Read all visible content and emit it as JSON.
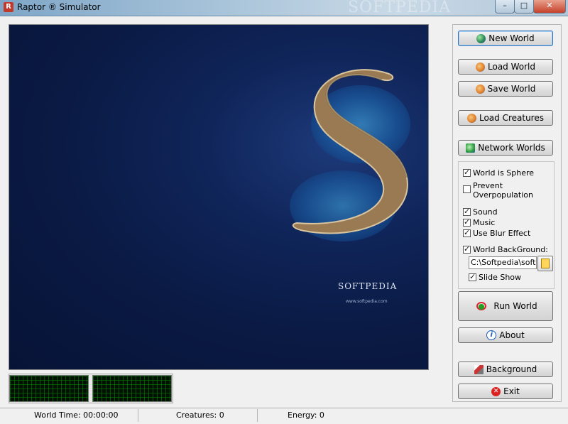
{
  "window": {
    "title": "Raptor ® Simulator",
    "watermark": "SOFTPEDIA",
    "controls": {
      "minimize": "–",
      "maximize": "□",
      "close": "✕"
    }
  },
  "world": {
    "watermark": "SOFTPEDIA",
    "watermark_url": "www.softpedia.com",
    "overlay_text": "SOFTPEDIA",
    "overlay_url": "www.softpedia.com"
  },
  "buttons": {
    "new_world": "New World",
    "load_world": "Load World",
    "save_world": "Save World",
    "load_creatures": "Load Creatures",
    "network_worlds": "Network Worlds",
    "run_world": "Run World",
    "about": "About",
    "background": "Background",
    "exit": "Exit"
  },
  "options": {
    "world_is_sphere": {
      "label": "World is Sphere",
      "checked": true
    },
    "prevent_overpopulation": {
      "label": "Prevent Overpopulation",
      "checked": false
    },
    "sound": {
      "label": "Sound",
      "checked": true
    },
    "music": {
      "label": "Music",
      "checked": true
    },
    "use_blur_effect": {
      "label": "Use Blur Effect",
      "checked": true
    },
    "world_background": {
      "label": "World BackGround:",
      "checked": true
    },
    "background_path": "C:\\Softpedia\\softpedia",
    "slide_show": {
      "label": "Slide Show",
      "checked": true
    }
  },
  "status": {
    "world_time": "World Time: 00:00:00",
    "creatures": "Creatures: 0",
    "energy": "Energy: 0"
  },
  "colors": {
    "accent": "#2f6fb5",
    "world_bg": "#0a1a44"
  },
  "icons": {
    "new_world": "globe-icon",
    "load_world": "folder-globe-icon",
    "save_world": "save-globe-icon",
    "load_creatures": "creatures-icon",
    "network_worlds": "network-icon",
    "run_world": "run-icon",
    "about": "info-icon",
    "background": "background-icon",
    "exit": "exit-icon"
  }
}
